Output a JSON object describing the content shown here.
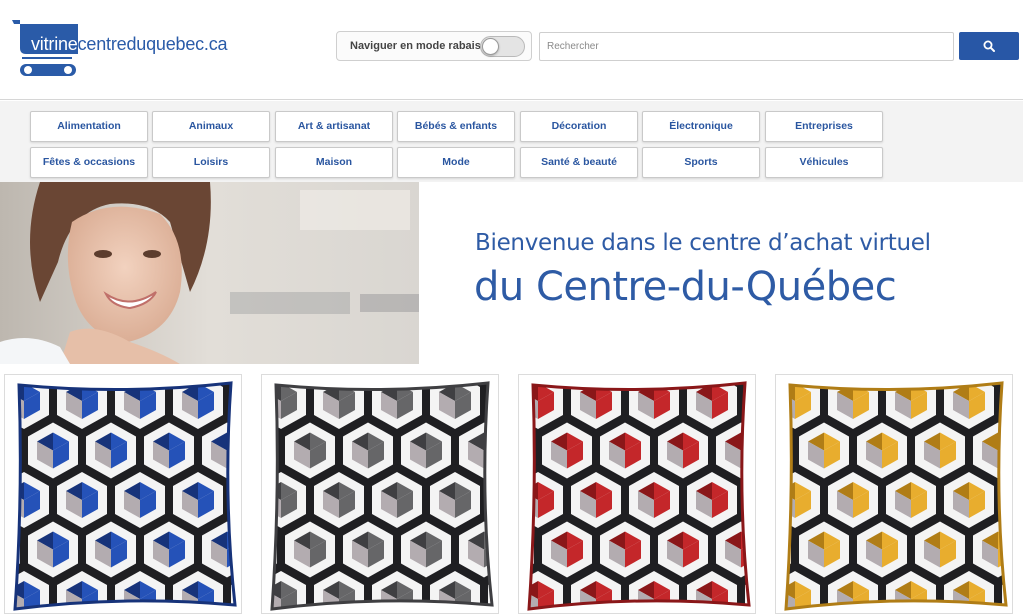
{
  "logo": {
    "part1": "vitrine",
    "part2": "centreduquebec.ca"
  },
  "discount_mode": {
    "label": "Naviguer en mode rabais",
    "enabled": false
  },
  "search": {
    "placeholder": "Rechercher",
    "value": "",
    "icon": "search-icon"
  },
  "categories": [
    "Alimentation",
    "Animaux",
    "Art & artisanat",
    "Bébés & enfants",
    "Décoration",
    "Électronique",
    "Entreprises",
    "Fêtes & occasions",
    "Loisirs",
    "Maison",
    "Mode",
    "Santé & beauté",
    "Sports",
    "Véhicules"
  ],
  "hero": {
    "line1": "Bienvenue dans le centre d’achat virtuel",
    "line2": "du Centre-du-Québec"
  },
  "products": [
    {
      "color": "#2552b8",
      "shade": "#17337a"
    },
    {
      "color": "#666668",
      "shade": "#3f3f42"
    },
    {
      "color": "#c4272a",
      "shade": "#8a1719"
    },
    {
      "color": "#e8ad2e",
      "shade": "#b07d16"
    }
  ],
  "colors": {
    "brand_blue": "#2a5ba8",
    "search_button": "#2857a6"
  }
}
